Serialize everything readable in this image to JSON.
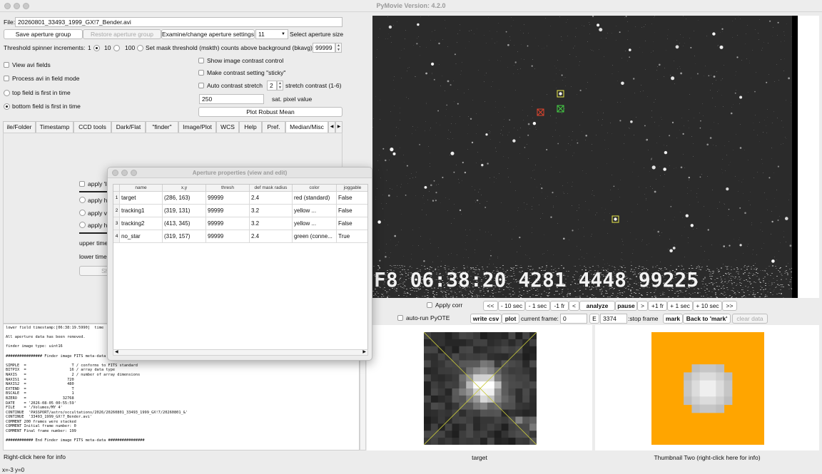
{
  "window": {
    "title": "PyMovie  Version: 4.2.0"
  },
  "file": {
    "label": "File:",
    "value": "20260801_33493_1999_GX!7_Bender.avi"
  },
  "controls": {
    "save_aperture_group": "Save aperture group",
    "restore_aperture_group": "Restore aperture group",
    "examine_aperture_settings": "Examine/change aperture settings",
    "aperture_size_value": "11",
    "select_aperture_size": "Select aperture size",
    "threshold_label": "Threshold spinner increments:",
    "threshold_options": [
      "1",
      "10",
      "100"
    ],
    "set_mask_threshold": "Set mask threshold (mskth) counts above background (bkavg)",
    "mask_threshold_value": "99999",
    "view_avi_fields": "View avi fields",
    "process_avi_field_mode": "Process avi in field mode",
    "top_field_first": "top field is first in time",
    "bottom_field_first": "bottom field is first in time",
    "show_contrast_control": "Show image contrast control",
    "sticky_contrast": "Make contrast setting \"sticky\"",
    "auto_contrast_stretch": "Auto contrast stretch",
    "stretch_value": "2",
    "stretch_label": "stretch contrast (1-6)",
    "sat_value": "250",
    "sat_label": "sat. pixel value",
    "plot_robust_mean": "Plot Robust Mean"
  },
  "tabs": [
    "ile/Folder",
    "Timestamp",
    "CCD tools",
    "Dark/Flat",
    "\"finder\"",
    "Image/Plot",
    "WCS",
    "Help",
    "Pref.",
    "Median/Misc"
  ],
  "tab_panel": {
    "apply_li": "apply 'li",
    "apply_ho_1": "apply ho",
    "apply_ve": "apply ve",
    "apply_ho_2": "apply ho",
    "upper_time": "upper time",
    "lower_time": "lower times",
    "show_btn": "Sh"
  },
  "log_lines": [
    "lower field timestamp:[06:38:19.5990]  time",
    "",
    "All aperture data has been removed.",
    "",
    "finder image type: uint16",
    "",
    "################ Finder image FITS meta-data",
    "",
    "SIMPLE  =                    T / conforms to FITS standard",
    "BITPIX  =                   16 / array data type",
    "NAXIS   =                    2 / number of array dimensions",
    "NAXIS1  =                  720",
    "NAXIS2  =                  480",
    "EXTEND  =                    T",
    "BSCALE  =                    1",
    "BZERO   =                32768",
    "DATE    = '2026-08-05 00:55:59'",
    "FILE    = '/Volumes/MY 4'",
    "CONTINUE  'PASSPORT/astro/occultations/2026/20260801_33493_1999_GX!7/20260801_&'",
    "CONTINUE  '33493_1999_GX!7_Bender.avi'",
    "COMMENT 200 frames were stacked",
    "COMMENT Initial frame number: 0",
    "COMMENT Final frame number: 199",
    "",
    "############ End Finder image FITS meta-data ################"
  ],
  "bottom_left": {
    "info": "Right-click here for info",
    "coords": "x=-3 y=0"
  },
  "video_overlay": "F8 06:38:20 4281 4448 99225",
  "playback": {
    "apply_corr": "Apply corr",
    "back_page": "<<",
    "minus_10_sec": "- 10 sec",
    "minus_1_sec": "- 1 sec",
    "minus_1_fr": "-1 fr",
    "back_one": "<",
    "analyze": "analyze",
    "pause": "pause",
    "forward_one": ">",
    "plus_1_fr": "+1 fr",
    "plus_1_sec": "+ 1 sec",
    "plus_10_sec": "+ 10 sec",
    "forward_page": ">>",
    "auto_run_pyote": "auto-run PyOTE",
    "write_csv": "write csv",
    "plot": "plot",
    "current_frame_label": "current frame:",
    "current_frame_value": "0",
    "e_button": "E",
    "stop_frame_value": "3374",
    "stop_frame_label": ":stop frame",
    "mark": "mark",
    "back_to_mark": "Back to 'mark'",
    "clear_data": "clear data"
  },
  "thumbnails": {
    "one_caption": "target",
    "two_caption": "Thumbnail Two (right-click here for info)"
  },
  "dialog": {
    "title": "Aperture properties (view and edit)",
    "columns": [
      "name",
      "x,y",
      "thresh",
      "def mask radius",
      "color",
      "joggable"
    ],
    "rows": [
      {
        "num": "1",
        "name": "target",
        "xy": "(286, 163)",
        "thresh": "99999",
        "radius": "2.4",
        "color": "red (standard)",
        "joggable": "False"
      },
      {
        "num": "2",
        "name": "tracking1",
        "xy": "(319, 131)",
        "thresh": "99999",
        "radius": "3.2",
        "color": "yellow ...",
        "joggable": "False"
      },
      {
        "num": "3",
        "name": "tracking2",
        "xy": "(413, 345)",
        "thresh": "99999",
        "radius": "3.2",
        "color": "yellow ...",
        "joggable": "False"
      },
      {
        "num": "4",
        "name": "no_star",
        "xy": "(319, 157)",
        "thresh": "99999",
        "radius": "2.4",
        "color": "green (conne...",
        "joggable": "True"
      }
    ]
  },
  "colors": {
    "aperture_target": "#e0442e",
    "aperture_tracking": "#e8e84a",
    "aperture_nostar": "#44cc44",
    "thumb_two_bg": "#ffa500"
  }
}
